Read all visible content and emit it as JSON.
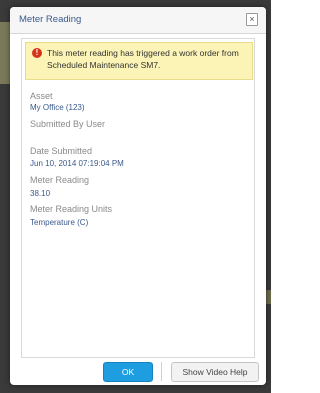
{
  "dialog": {
    "title": "Meter Reading",
    "close_label": "×"
  },
  "alert": {
    "icon": "!",
    "message": "This meter reading has triggered a work order from Scheduled Maintenance SM7."
  },
  "fields": {
    "asset_label": "Asset",
    "asset_value": "My Office (123)",
    "submitted_by_label": "Submitted By User",
    "date_submitted_label": "Date Submitted",
    "date_submitted_value": "Jun 10, 2014 07:19:04 PM",
    "meter_reading_label": "Meter Reading",
    "meter_reading_value": "38.10",
    "units_label": "Meter Reading Units",
    "units_value": "Temperature (C)"
  },
  "footer": {
    "ok_label": "OK",
    "help_label": "Show Video Help"
  },
  "colors": {
    "ok_button": "#1e9ee0",
    "alert_background": "#fbf4b6",
    "alert_icon": "#d4341a",
    "value_text": "#3a5a8c"
  }
}
